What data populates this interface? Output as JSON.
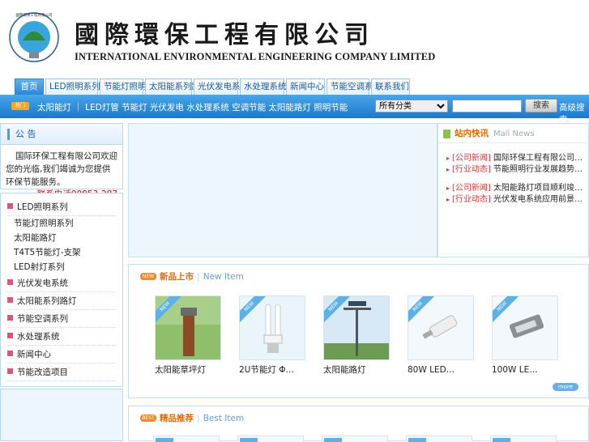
{
  "header": {
    "company_zh": "國際環保工程有限公司",
    "company_en": "INTERNATIONAL ENVIRONMENTAL ENGINEERING COMPANY LIMITED",
    "logo_ring_text": "INTERNATIONAL ENVIRONMENTAL ENGINEERING CO LTD"
  },
  "nav": {
    "tabs": [
      "首页",
      "LED照明系列",
      "节能灯照明系列",
      "太阳能系列路灯",
      "光伏发电系统",
      "水处理系统",
      "新闻中心",
      "节能空调系列",
      "联系我们"
    ]
  },
  "searchbar": {
    "hot_label": "热门",
    "hot_terms": "太阳能灯 ｜ LED灯管 节能灯 光伏发电 水处理系统 空调节能 太阳能路灯 照明节能",
    "category_select": "所有分类",
    "search_button": "搜索",
    "advanced_link": "高级搜索"
  },
  "notice": {
    "title": "公 告",
    "text": "国际环保工程有限公司欢迎您的光临,我们竭诚为您提供环保节能服务。",
    "tel": "联系电话00853-287"
  },
  "categories": [
    {
      "label": "LED照明系列",
      "plus": true
    },
    {
      "label": "节能灯照明系列",
      "plus": false
    },
    {
      "label": "太阳能路灯",
      "plus": false
    },
    {
      "label": "T4T5节能灯-支架",
      "plus": false
    },
    {
      "label": "LED射灯系列",
      "plus": false
    },
    {
      "label": "光伏发电系统",
      "plus": true
    },
    {
      "label": "太阳能系列路灯",
      "plus": true
    },
    {
      "label": "节能空调系列",
      "plus": true
    },
    {
      "label": "水处理系统",
      "plus": true
    },
    {
      "label": "新闻中心",
      "plus": true
    },
    {
      "label": "节能改造项目",
      "plus": true
    }
  ],
  "news": {
    "title_zh": "站内快讯",
    "title_en": "Mall News",
    "items": [
      {
        "tag": "[公司新闻]",
        "text": "国际环保工程有限公司…"
      },
      {
        "tag": "[行业动态]",
        "text": "节能照明行业发展趋势…"
      },
      {
        "tag": "[公司新闻]",
        "text": "太阳能路灯项目顺利竣…"
      },
      {
        "tag": "[行业动态]",
        "text": "光伏发电系统应用前景…"
      }
    ]
  },
  "new_items": {
    "tag": "NEW",
    "title_zh": "新品上市",
    "title_en": "New Item",
    "ribbon": "NEW",
    "more": "more",
    "products": [
      {
        "name": "太阳能草坪灯"
      },
      {
        "name": "2U节能灯 Φ…"
      },
      {
        "name": "太阳能路灯"
      },
      {
        "name": "80W LED…"
      },
      {
        "name": "100W LE…"
      }
    ]
  },
  "recommended": {
    "tag": "BEST",
    "title_zh": "精品推荐",
    "title_en": "Best Item"
  }
}
